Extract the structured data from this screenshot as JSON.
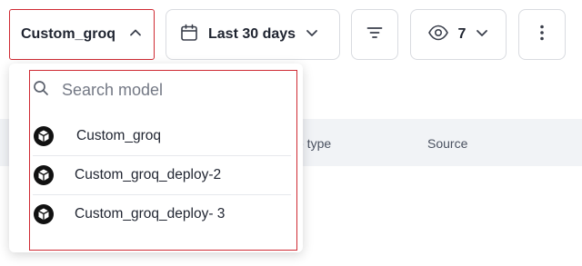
{
  "toolbar": {
    "model_selector": {
      "label": "Custom_groq",
      "icon": "chevron-up-icon"
    },
    "date_range": {
      "label": "Last 30 days",
      "icon": "calendar-icon",
      "chevron": "chevron-down-icon"
    },
    "filter": {
      "icon": "filter-lines-icon"
    },
    "columns": {
      "label": "7",
      "icon": "eye-icon",
      "chevron": "chevron-down-icon"
    },
    "more": {
      "icon": "kebab-vertical-icon"
    }
  },
  "table": {
    "headers": [
      "e type",
      "Source"
    ]
  },
  "dropdown": {
    "search": {
      "placeholder": "Search model",
      "value": "",
      "icon": "search-icon"
    },
    "options": [
      {
        "label": "Custom_groq",
        "icon": "model-cube-icon"
      },
      {
        "label": "Custom_groq_deploy-2",
        "icon": "model-cube-icon"
      },
      {
        "label": "Custom_groq_deploy- 3",
        "icon": "model-cube-icon"
      }
    ]
  },
  "colors": {
    "highlight": "#cf2a33",
    "header_bg": "#f1f3f6",
    "border": "#d9dbe0"
  }
}
